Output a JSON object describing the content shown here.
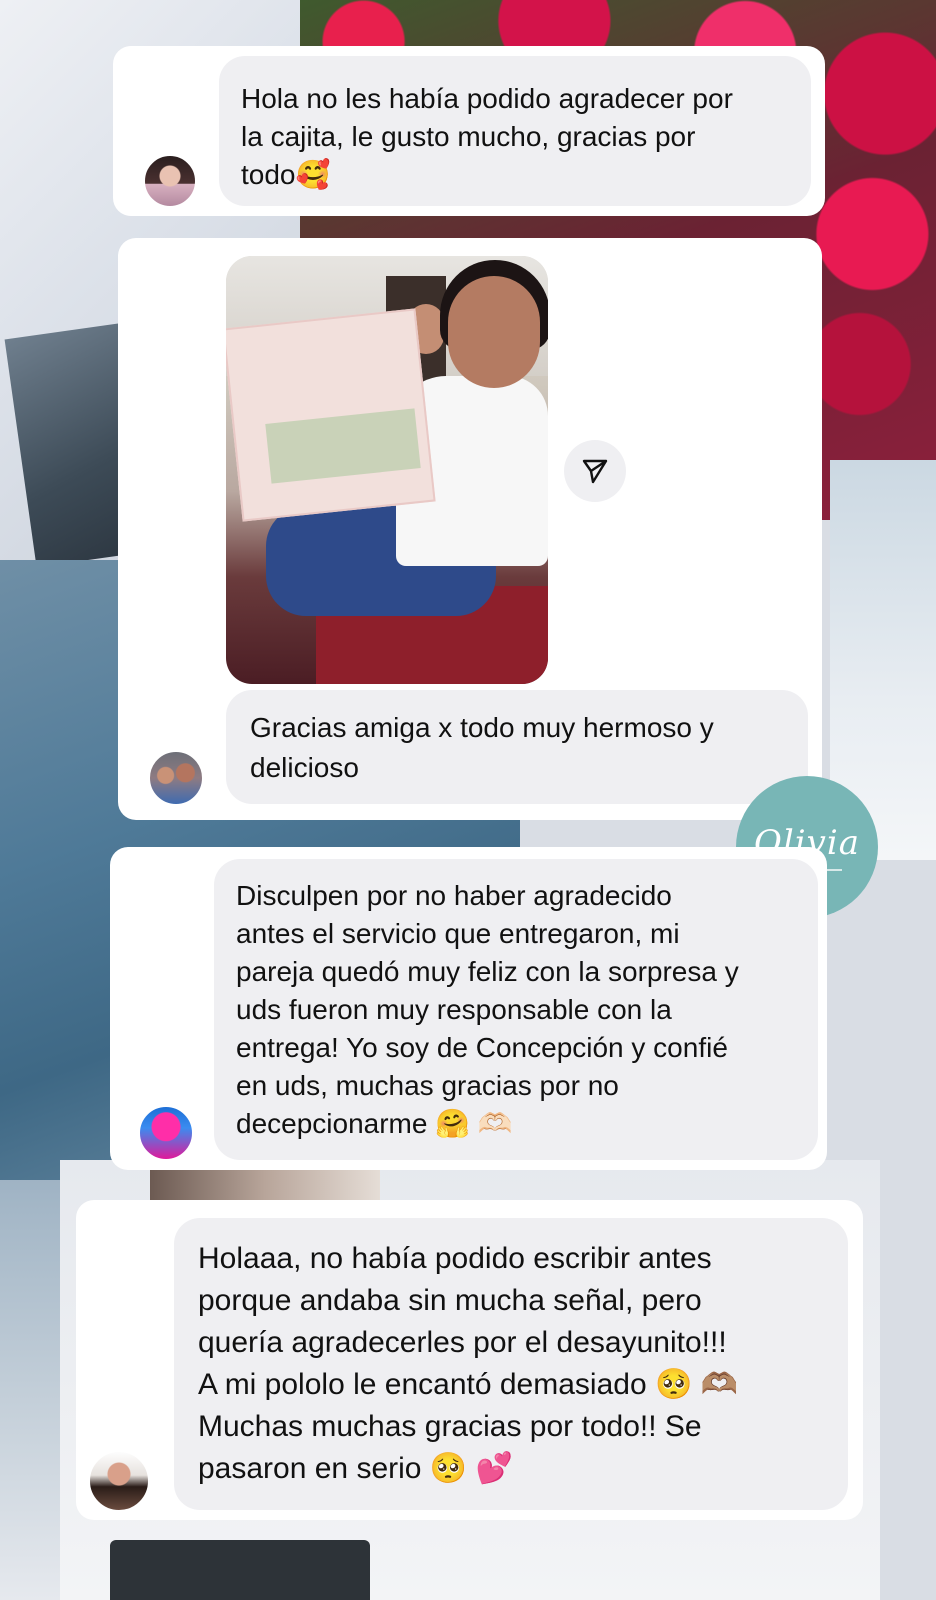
{
  "messages": [
    {
      "text": "Hola no les había podido agradecer por\nla cajita, le gusto mucho, gracias por\ntodo🥰",
      "avatar": "user-avatar-1"
    },
    {
      "text": "Gracias amiga x todo muy hermoso y\ndelicioso",
      "avatar": "user-avatar-2",
      "has_photo": true
    },
    {
      "text": "Disculpen por no haber agradecido\nantes el servicio que entregaron, mi\npareja quedó muy feliz con la sorpresa y\nuds fueron muy responsable con la\nentrega! Yo soy de Concepción y confié\nen uds, muchas gracias por no\ndecepcionarme 🤗 🫶🏻",
      "avatar": "user-avatar-3"
    },
    {
      "text": "Holaaa, no había podido escribir antes\nporque andaba sin mucha señal, pero\nquería agradecerles por el desayunito!!!\nA mi pololo le encantó demasiado 🥺 🫶🏽\nMuchas muchas gracias por todo!! Se\npasaron en serio 🥺 💕",
      "avatar": "user-avatar-4"
    }
  ],
  "logo": {
    "text": "Olivia",
    "color": "#78b6b6"
  },
  "icons": {
    "share": "share-icon"
  },
  "colors": {
    "bubble": "#efeff2",
    "card": "#ffffff",
    "text": "#111111"
  }
}
